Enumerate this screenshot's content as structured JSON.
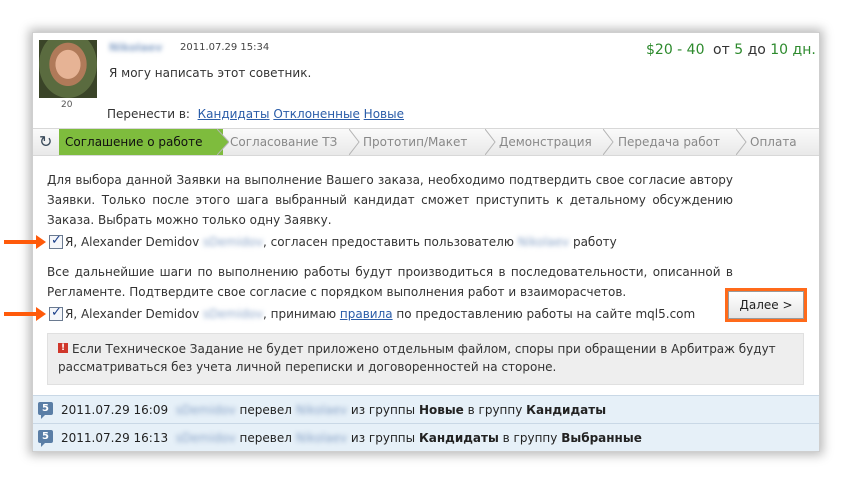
{
  "header": {
    "username": "Nikolaev",
    "date": "2011.07.29 15:34",
    "message": "Я могу написать этот советник.",
    "avatar_count": "20",
    "price": "$20 - 40",
    "term_from_label": "от",
    "term_from": "5",
    "term_to_label": "до",
    "term_to": "10 дн.",
    "move_label": "Перенести в:",
    "move_links": [
      "Кандидаты",
      "Отклоненные",
      "Новые"
    ]
  },
  "steps": [
    {
      "label": "Соглашение о работе",
      "active": true
    },
    {
      "label": "Согласование ТЗ",
      "active": false
    },
    {
      "label": "Прототип/Макет",
      "active": false
    },
    {
      "label": "Демонстрация",
      "active": false
    },
    {
      "label": "Передача работ",
      "active": false
    },
    {
      "label": "Оплата",
      "active": false
    }
  ],
  "agreement": {
    "intro": "Для выбора данной Заявки на выполнение Вашего заказа, необходимо подтвердить свое согласие автору Заявки. Только после этого шага выбранный кандидат сможет приступить к детальному обсуждению Заказа. Выбрать можно только одну Заявку.",
    "cb1_prefix": "Я, Alexander Demidov",
    "cb1_user": "sDemidov",
    "cb1_mid": ", согласен предоставить пользователю",
    "cb1_user2": "Nikolaev",
    "cb1_suffix": "работу",
    "steps_text": "Все дальнейшие шаги по выполнению работы будут производиться в последовательности, описанной в Регламенте. Подтвердите свое согласие с порядком выполнения работ и взаиморасчетов.",
    "cb2_prefix": "Я, Alexander Demidov",
    "cb2_user": "sDemidov",
    "cb2_mid": ", принимаю",
    "cb2_link": "правила",
    "cb2_suffix": "по предоставлению работы на сайте mql5.com",
    "next_button": "Далее >",
    "warning_icon": "!",
    "warning": "Если Техническое Задание не будет приложено отдельным файлом, споры при обращении в Арбитраж будут рассматриваться без учета личной переписки и договоренностей на стороне."
  },
  "history": [
    {
      "icon": "5",
      "date": "2011.07.29 16:09",
      "actor": "sDemidov",
      "verb": "перевел",
      "target": "Nikolaev",
      "from_label": "из группы",
      "from": "Новые",
      "to_label": "в группу",
      "to": "Кандидаты"
    },
    {
      "icon": "5",
      "date": "2011.07.29 16:13",
      "actor": "sDemidov",
      "verb": "перевел",
      "target": "Nikolaev",
      "from_label": "из группы",
      "from": "Кандидаты",
      "to_label": "в группу",
      "to": "Выбранные"
    }
  ],
  "colors": {
    "active_step": "#7ebc3d",
    "price": "#2d8a2d",
    "highlight": "#ff6a1a",
    "link": "#2a5ca8"
  }
}
